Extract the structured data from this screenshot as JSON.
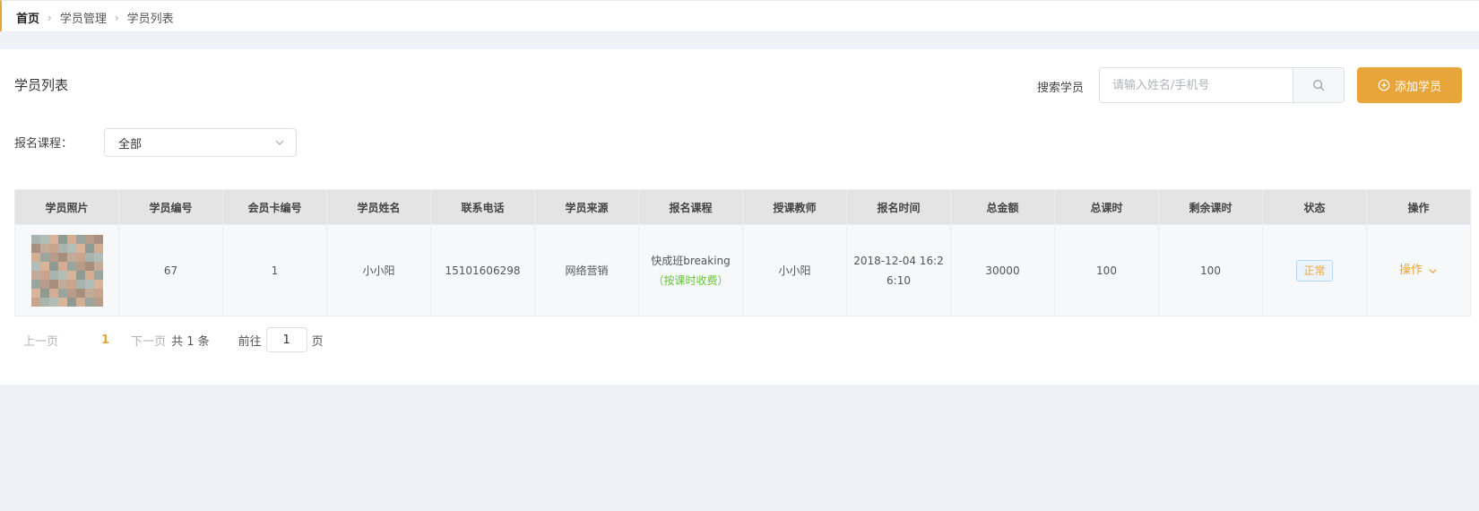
{
  "breadcrumb": {
    "home": "首页",
    "items": [
      "学员管理",
      "学员列表"
    ]
  },
  "page": {
    "title": "学员列表",
    "search_label": "搜索学员",
    "search_placeholder": "请输入姓名/手机号",
    "add_button": "添加学员",
    "filter_label": "报名课程：",
    "filter_value": "全部"
  },
  "table": {
    "headers": [
      "学员照片",
      "学员编号",
      "会员卡编号",
      "学员姓名",
      "联系电话",
      "学员来源",
      "报名课程",
      "授课教师",
      "报名时间",
      "总金额",
      "总课时",
      "剩余课时",
      "状态",
      "操作"
    ],
    "rows": [
      {
        "student_no": "67",
        "card_no": "1",
        "name": "小小阳",
        "phone": "15101606298",
        "source": "网络营销",
        "course": "快成班breaking",
        "course_note": "（按课时收费）",
        "teacher": "小小阳",
        "enroll_time_1": "2018-12-04 16:2",
        "enroll_time_2": "6:10",
        "amount": "30000",
        "total_hours": "100",
        "remaining_hours": "100",
        "status": "正常",
        "action": "操作"
      }
    ]
  },
  "pagination": {
    "prev": "上一页",
    "current": "1",
    "next": "下一页",
    "total": "共 1 条",
    "goto": "前往",
    "goto_value": "1",
    "unit": "页"
  },
  "colors": {
    "accent": "#e8a53a",
    "success": "#67c23a",
    "header_bg": "#e4e4e4",
    "page_bg": "#eef1f7"
  },
  "icons": {
    "search": "search-icon",
    "add": "plus-circle-icon",
    "dropdown": "chevron-down-icon",
    "breadcrumb_sep": "chevron-right-icon"
  }
}
